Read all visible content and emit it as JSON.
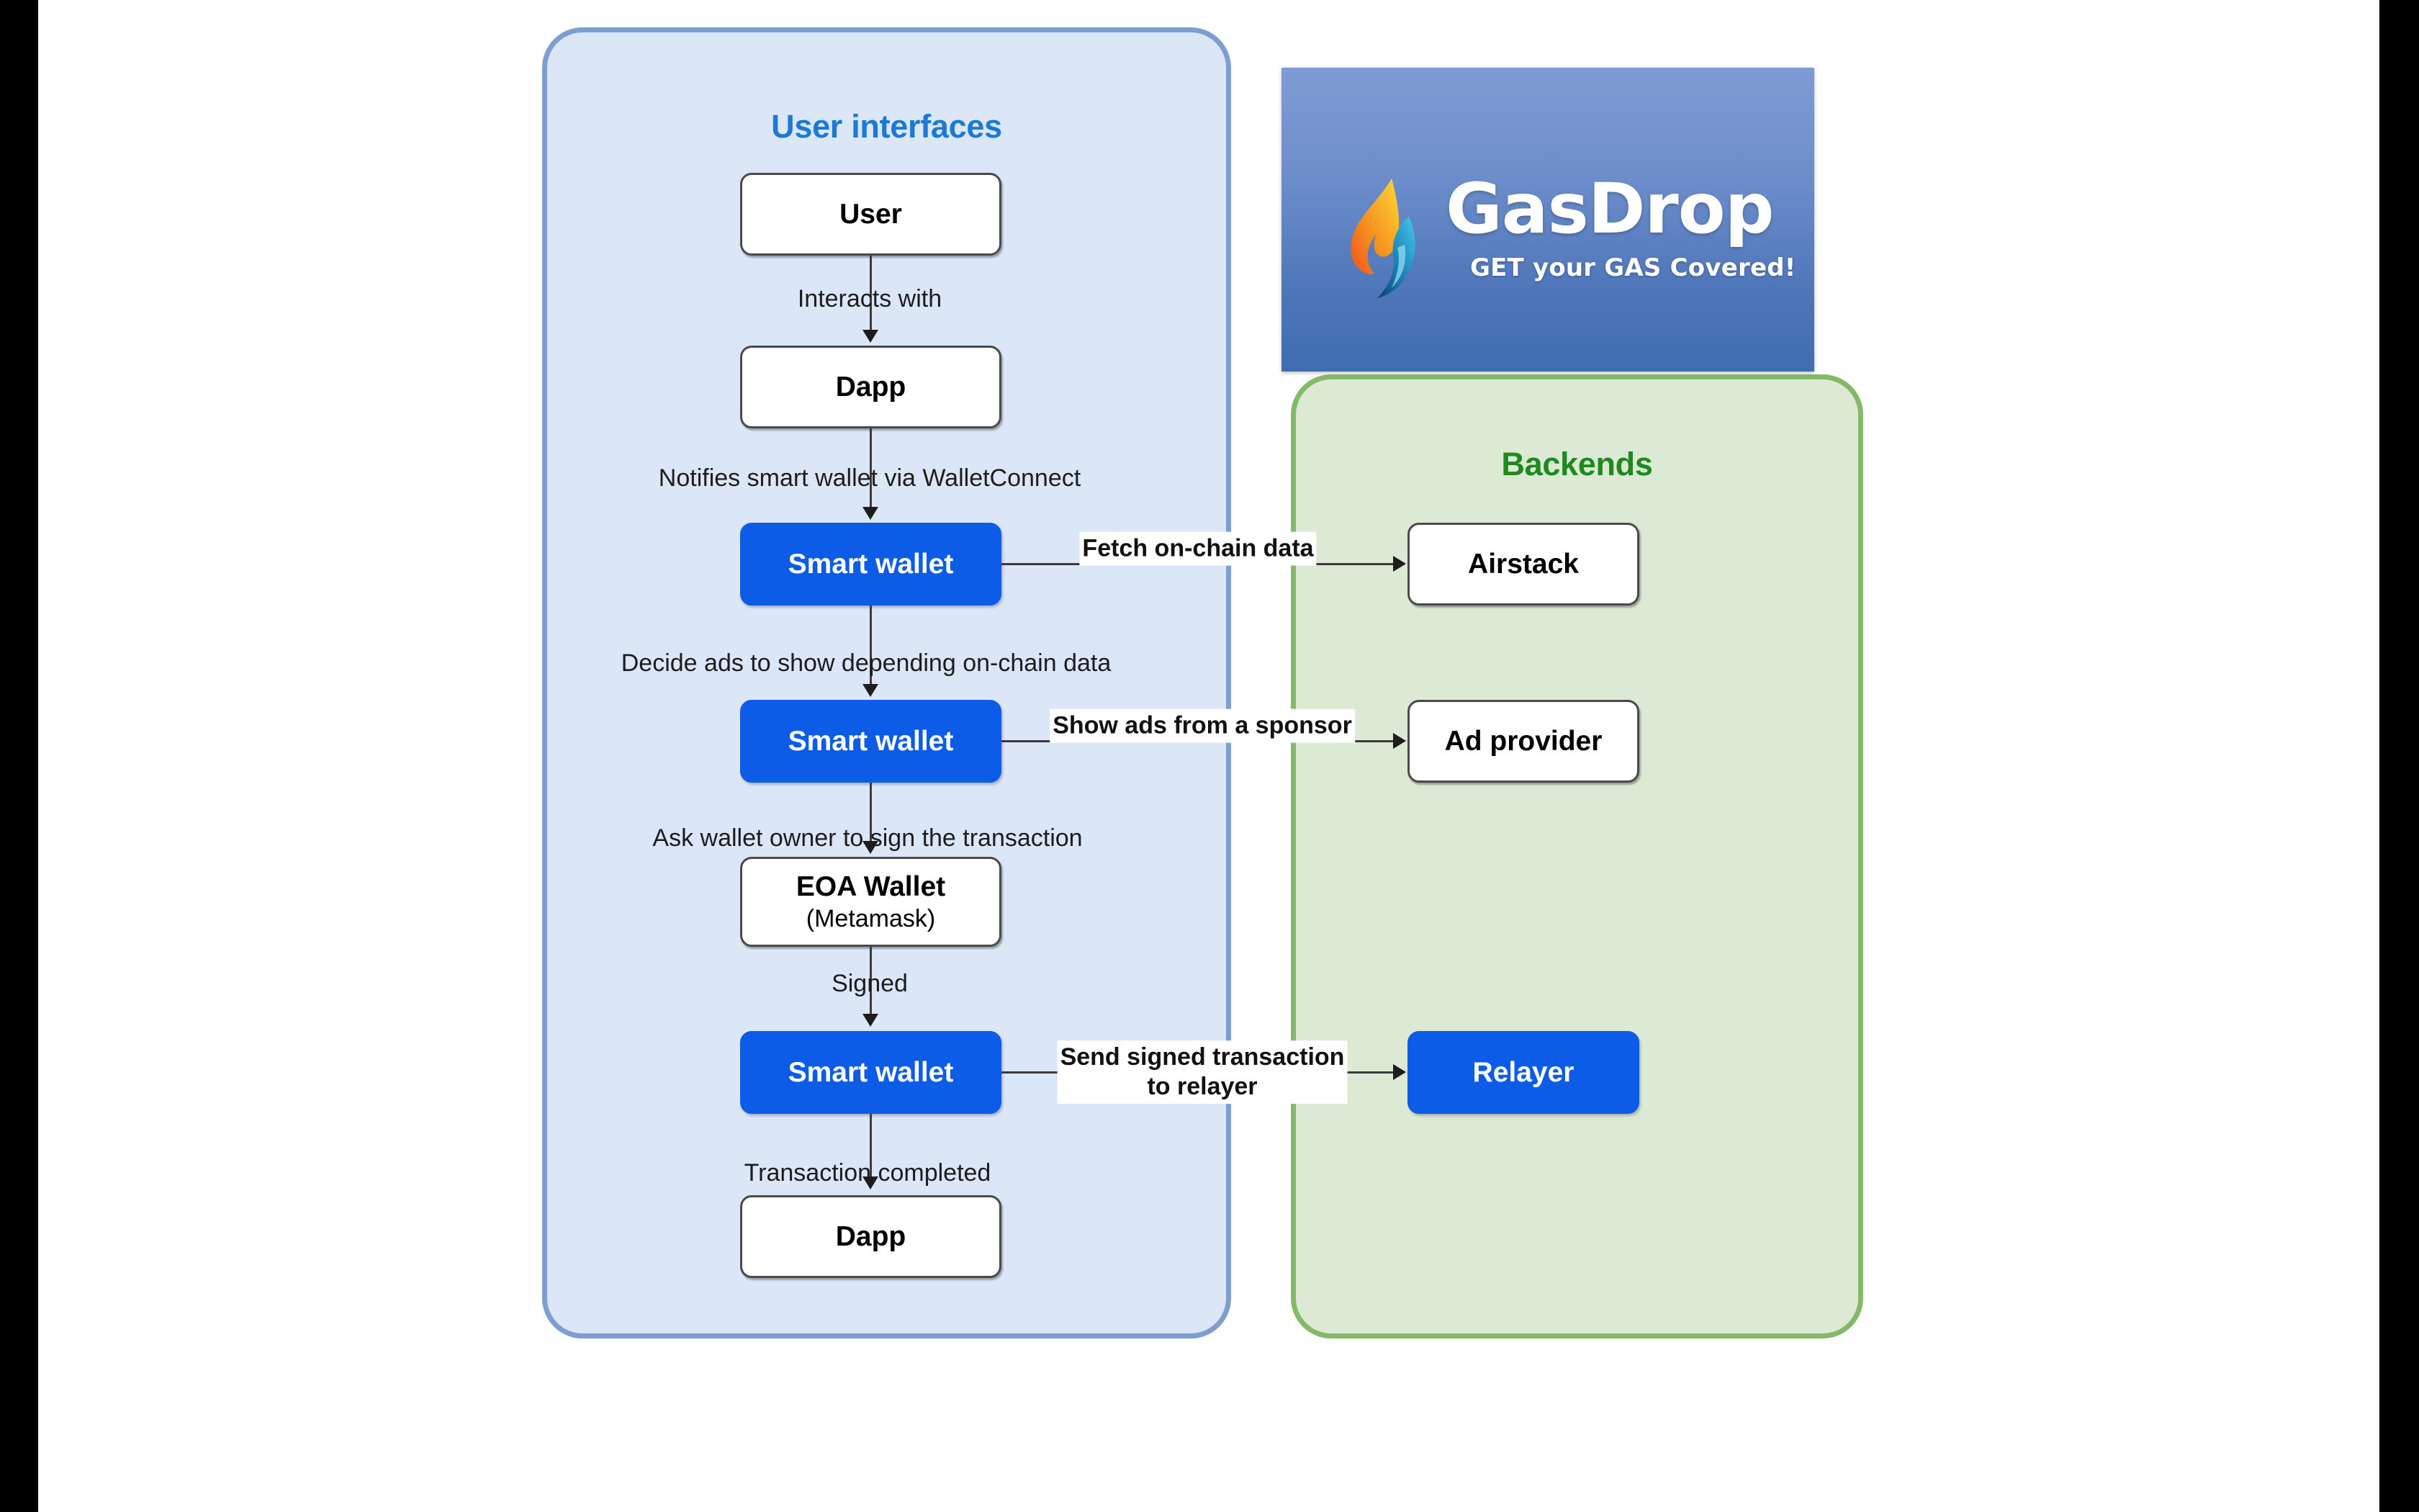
{
  "slide": {
    "background": "#ffffff",
    "letterbox_color": "#000000"
  },
  "logo": {
    "icon": "flame-icon",
    "wordmark": "GasDrop",
    "tagline": "GET your GAS Covered!",
    "bg_top": "#7e9bd4",
    "bg_bottom": "#3e6db0"
  },
  "panels": {
    "user_interfaces": {
      "title": "User interfaces",
      "title_color": "#1b79d8",
      "fill": "#dbe6f7",
      "border": "#7c9fcf"
    },
    "backends": {
      "title": "Backends",
      "title_color": "#1e8a1e",
      "fill": "#dce9d5",
      "border": "#84b96a"
    }
  },
  "nodes": {
    "user": {
      "label": "User",
      "style": "white"
    },
    "dapp_top": {
      "label": "Dapp",
      "style": "white"
    },
    "smart_wallet_1": {
      "label": "Smart wallet",
      "style": "blue"
    },
    "smart_wallet_2": {
      "label": "Smart wallet",
      "style": "blue"
    },
    "eoa_wallet": {
      "label": "EOA Wallet",
      "sub": "(Metamask)",
      "style": "white"
    },
    "smart_wallet_3": {
      "label": "Smart wallet",
      "style": "blue"
    },
    "dapp_bottom": {
      "label": "Dapp",
      "style": "white"
    },
    "airstack": {
      "label": "Airstack",
      "style": "white"
    },
    "ad_provider": {
      "label": "Ad provider",
      "style": "white"
    },
    "relayer": {
      "label": "Relayer",
      "style": "blue"
    }
  },
  "edges": {
    "user_to_dapp": "Interacts with",
    "dapp_to_wallet": "Notifies smart wallet via WalletConnect",
    "wallet_to_airstack": "Fetch on-chain data",
    "wallet1_to_wallet2": "Decide ads to show depending on-chain data",
    "wallet_to_adprovider": "Show ads from a sponsor",
    "wallet2_to_eoa": "Ask wallet owner to sign the transaction",
    "eoa_to_wallet3": "Signed",
    "wallet_to_relayer_line1": "Send signed transaction",
    "wallet_to_relayer_line2": "to relayer",
    "wallet3_to_dapp": "Transaction completed"
  },
  "colors": {
    "node_blue": "#0d5ce8",
    "node_white": "#ffffff",
    "connector": "#3b3b3b"
  }
}
